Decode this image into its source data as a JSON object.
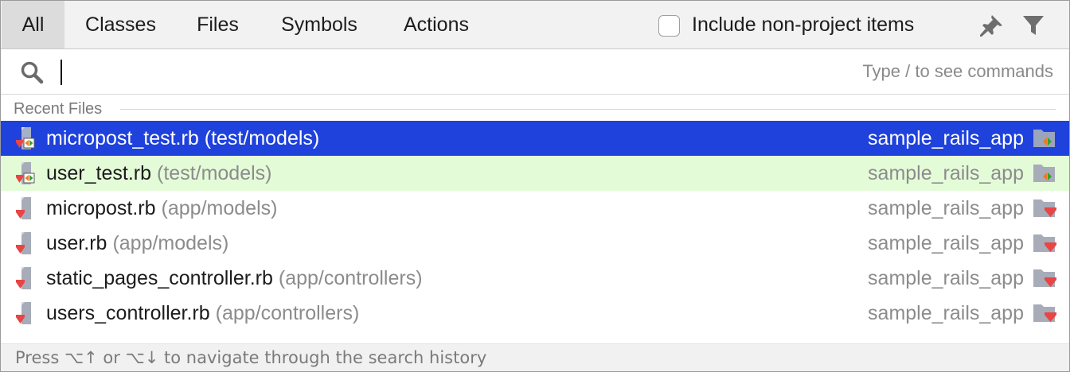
{
  "tabs": [
    {
      "label": "All",
      "selected": true
    },
    {
      "label": "Classes",
      "selected": false
    },
    {
      "label": "Files",
      "selected": false
    },
    {
      "label": "Symbols",
      "selected": false
    },
    {
      "label": "Actions",
      "selected": false
    }
  ],
  "options": {
    "include_non_project_label": "Include non-project items",
    "include_non_project_checked": false,
    "pin_icon": "pin-icon",
    "filter_icon": "filter-icon"
  },
  "search": {
    "value": "",
    "placeholder": "",
    "hint": "Type / to see commands",
    "icon": "search-icon"
  },
  "section": {
    "title": "Recent Files"
  },
  "results": [
    {
      "name": "micropost_test.rb",
      "path": "(test/models)",
      "project": "sample_rails_app",
      "icon": "ruby-test-file-icon",
      "state": "selected"
    },
    {
      "name": "user_test.rb",
      "path": "(test/models)",
      "project": "sample_rails_app",
      "icon": "ruby-test-file-icon",
      "state": "highlighted"
    },
    {
      "name": "micropost.rb",
      "path": "(app/models)",
      "project": "sample_rails_app",
      "icon": "ruby-file-icon",
      "state": "normal"
    },
    {
      "name": "user.rb",
      "path": "(app/models)",
      "project": "sample_rails_app",
      "icon": "ruby-file-icon",
      "state": "normal"
    },
    {
      "name": "static_pages_controller.rb",
      "path": "(app/controllers)",
      "project": "sample_rails_app",
      "icon": "ruby-file-icon",
      "state": "normal"
    },
    {
      "name": "users_controller.rb",
      "path": "(app/controllers)",
      "project": "sample_rails_app",
      "icon": "ruby-file-icon",
      "state": "normal"
    }
  ],
  "status": {
    "text": "Press ⌥↑ or ⌥↓ to navigate through the search history"
  },
  "colors": {
    "selection": "#1f42dc",
    "highlight": "#e4fbd8",
    "ruby_red": "#e84545",
    "test_green": "#33a035",
    "test_orange": "#f07a1a"
  }
}
